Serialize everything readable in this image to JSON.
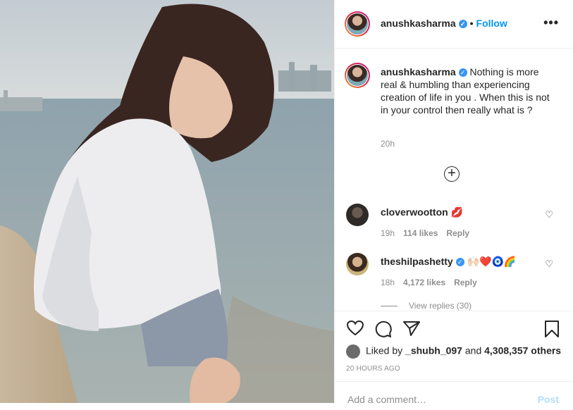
{
  "post": {
    "username": "anushkasharma",
    "verified_mark": "✓",
    "separator": "•",
    "follow_label": "Follow",
    "more_label": "•••",
    "caption_text": "Nothing is more real & humbling than experiencing creation of life in you . When this is not in your control then really what is ?",
    "posted_time": "20h",
    "load_more_icon": "plus-circle-icon"
  },
  "comments": [
    {
      "user": "cloverwootton",
      "text": "💋",
      "time": "19h",
      "likes": "114 likes",
      "reply": "Reply"
    },
    {
      "user": "theshilpashetty",
      "text": "🙌🏻❤️🧿🌈",
      "time": "18h",
      "likes": "4,172 likes",
      "reply": "Reply"
    }
  ],
  "view_replies_label": "View replies (30)",
  "actions": {
    "like_icon": "heart-icon",
    "comment_icon": "comment-icon",
    "share_icon": "share-icon",
    "save_icon": "bookmark-icon"
  },
  "likes": {
    "prefix": "Liked by",
    "user": "_shubh_097",
    "middle": "and",
    "count": "4,308,357 others"
  },
  "ago": "20 HOURS AGO",
  "add_comment": {
    "placeholder": "Add a comment…",
    "post_label": "Post"
  },
  "colors": {
    "link": "#0095f6",
    "muted": "#8e8e8e",
    "border": "#efefef",
    "verified": "#3897f0"
  }
}
